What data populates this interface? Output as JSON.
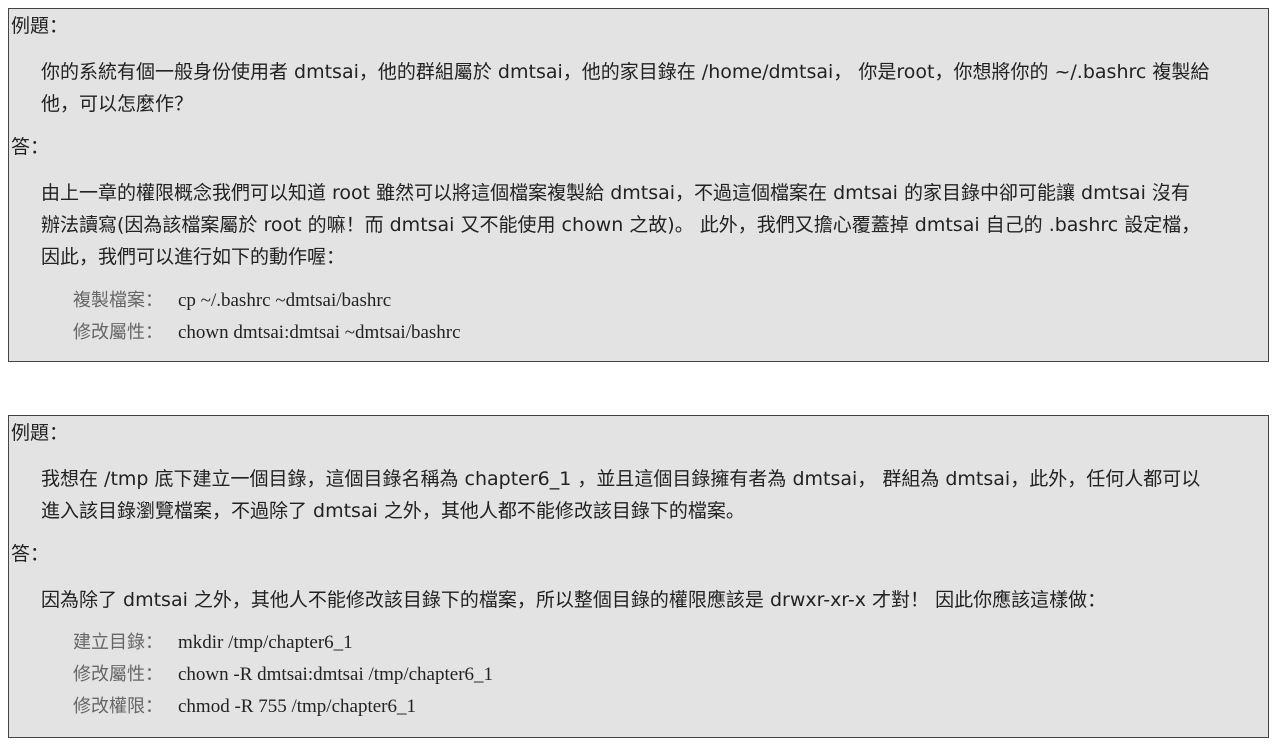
{
  "examples": [
    {
      "question_label": "例題：",
      "question_lines": [
        "你的系統有個一般身份使用者 dmtsai，他的群組屬於 dmtsai，他的家目錄在 /home/dmtsai， 你是root，你想將你的 ~/.bashrc 複製給",
        "他，可以怎麼作？"
      ],
      "answer_label": "答：",
      "answer_lines": [
        "由上一章的權限概念我們可以知道 root 雖然可以將這個檔案複製給 dmtsai，不過這個檔案在 dmtsai 的家目錄中卻可能讓 dmtsai 沒有",
        "辦法讀寫(因為該檔案屬於 root 的嘛！而 dmtsai 又不能使用 chown 之故)。 此外，我們又擔心覆蓋掉 dmtsai 自己的 .bashrc 設定檔，",
        "因此，我們可以進行如下的動作喔："
      ],
      "commands": [
        {
          "label": "複製檔案：",
          "command": "cp ~/.bashrc ~dmtsai/bashrc"
        },
        {
          "label": "修改屬性：",
          "command": "chown dmtsai:dmtsai ~dmtsai/bashrc"
        }
      ]
    },
    {
      "question_label": "例題：",
      "question_lines": [
        "我想在 /tmp 底下建立一個目錄，這個目錄名稱為 chapter6_1 ，並且這個目錄擁有者為 dmtsai， 群組為 dmtsai，此外，任何人都可以",
        "進入該目錄瀏覽檔案，不過除了 dmtsai 之外，其他人都不能修改該目錄下的檔案。"
      ],
      "answer_label": "答：",
      "answer_lines": [
        "因為除了 dmtsai 之外，其他人不能修改該目錄下的檔案，所以整個目錄的權限應該是 drwxr-xr-x 才對！ 因此你應該這樣做："
      ],
      "commands": [
        {
          "label": "建立目錄：",
          "command": "mkdir /tmp/chapter6_1"
        },
        {
          "label": "修改屬性：",
          "command": "chown -R dmtsai:dmtsai /tmp/chapter6_1"
        },
        {
          "label": "修改權限：",
          "command": "chmod -R 755 /tmp/chapter6_1"
        }
      ]
    }
  ]
}
